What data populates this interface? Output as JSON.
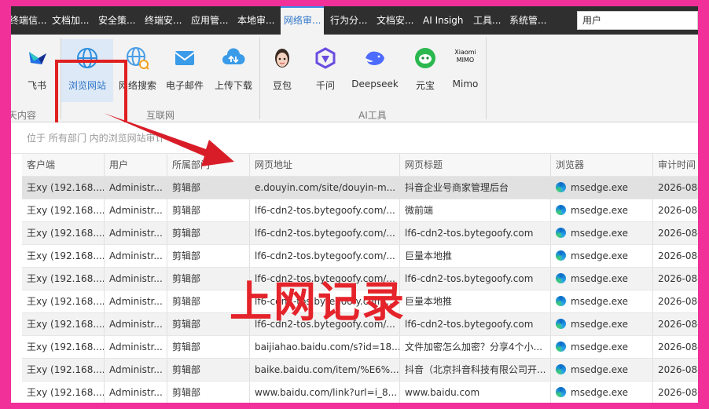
{
  "tabs": [
    {
      "label": "终端信..."
    },
    {
      "label": "文档加..."
    },
    {
      "label": "安全策..."
    },
    {
      "label": "终端安..."
    },
    {
      "label": "应用管..."
    },
    {
      "label": "本地审..."
    },
    {
      "label": "网络审...",
      "active": true
    },
    {
      "label": "行为分..."
    },
    {
      "label": "文档安..."
    },
    {
      "label": "AI Insigh"
    },
    {
      "label": "工具..."
    },
    {
      "label": "系统管..."
    }
  ],
  "search": {
    "value": "用户"
  },
  "ribbon": {
    "buttons": [
      {
        "label": "飞书",
        "icon": "feishu-icon"
      },
      {
        "label": "浏览网站",
        "icon": "globe-icon",
        "selected": true
      },
      {
        "label": "网络搜索",
        "icon": "globe-search-icon"
      },
      {
        "label": "电子邮件",
        "icon": "mail-icon"
      },
      {
        "label": "上传下载",
        "icon": "cloud-transfer-icon"
      },
      {
        "label": "豆包",
        "icon": "doubao-icon"
      },
      {
        "label": "千问",
        "icon": "qianwen-icon"
      },
      {
        "label": "Deepseek",
        "icon": "deepseek-icon"
      },
      {
        "label": "元宝",
        "icon": "yuanbao-icon"
      },
      {
        "label": "Mimo",
        "icon": "xiaomi-mimo-icon",
        "icon_text": "Xiaomi MIMO"
      }
    ],
    "groups": [
      "天内容",
      "互联网",
      "AI工具"
    ]
  },
  "info_text": "位于 所有部门 内的浏览网站审计",
  "table": {
    "headers": [
      "客户端",
      "用户",
      "所属部门",
      "网页地址",
      "网页标题",
      "浏览器",
      "审计时间"
    ],
    "rows": [
      [
        "王xy (192.168....",
        "Administr...",
        "剪辑部",
        "e.douyin.com/site/douyin-m...",
        "抖音企业号商家管理后台",
        "msedge.exe",
        "2026-08-"
      ],
      [
        "王xy (192.168....",
        "Administr...",
        "剪辑部",
        "lf6-cdn2-tos.bytegoofy.com/...",
        "微前端",
        "msedge.exe",
        "2026-08-"
      ],
      [
        "王xy (192.168....",
        "Administr...",
        "剪辑部",
        "lf6-cdn2-tos.bytegoofy.com/...",
        "lf6-cdn2-tos.bytegoofy.com",
        "msedge.exe",
        "2026-08-"
      ],
      [
        "王xy (192.168....",
        "Administr...",
        "剪辑部",
        "lf6-cdn2-tos.bytegoofy.com/...",
        "巨量本地推",
        "msedge.exe",
        "2026-08-"
      ],
      [
        "王xy (192.168....",
        "Administr...",
        "剪辑部",
        "lf6-cdn2-tos.bytegoofy.com/...",
        "lf6-cdn2-tos.bytegoofy.com",
        "msedge.exe",
        "2026-08-"
      ],
      [
        "王xy (192.168....",
        "Administr...",
        "剪辑部",
        "lf6-cdn2-tos.bytegoofy.com/...",
        "巨量本地推",
        "msedge.exe",
        "2026-08-"
      ],
      [
        "王xy (192.168....",
        "Administr...",
        "剪辑部",
        "lf6-cdn2-tos.bytegoofy.com/...",
        "lf6-cdn2-tos.bytegoofy.com",
        "msedge.exe",
        "2026-08-"
      ],
      [
        "王xy (192.168....",
        "Administr...",
        "剪辑部",
        "baijiahao.baidu.com/s?id=18...",
        "文件加密怎么加密？分享4个小...",
        "msedge.exe",
        "2026-08-"
      ],
      [
        "王xy (192.168....",
        "Administr...",
        "剪辑部",
        "baike.baidu.com/item/%E6%...",
        "抖音（北京抖音科技有限公司开...",
        "msedge.exe",
        "2026-08-"
      ],
      [
        "王xy (192.168....",
        "Administr...",
        "剪辑部",
        "www.baidu.com/link?url=i_8...",
        "www.baidu.com",
        "msedge.exe",
        "2026-08-"
      ]
    ]
  },
  "overlay_text": "上网记录",
  "colors": {
    "frame_border": "#f1309a",
    "annotation_red": "#e02020",
    "active_tab": "#2f75c9"
  }
}
